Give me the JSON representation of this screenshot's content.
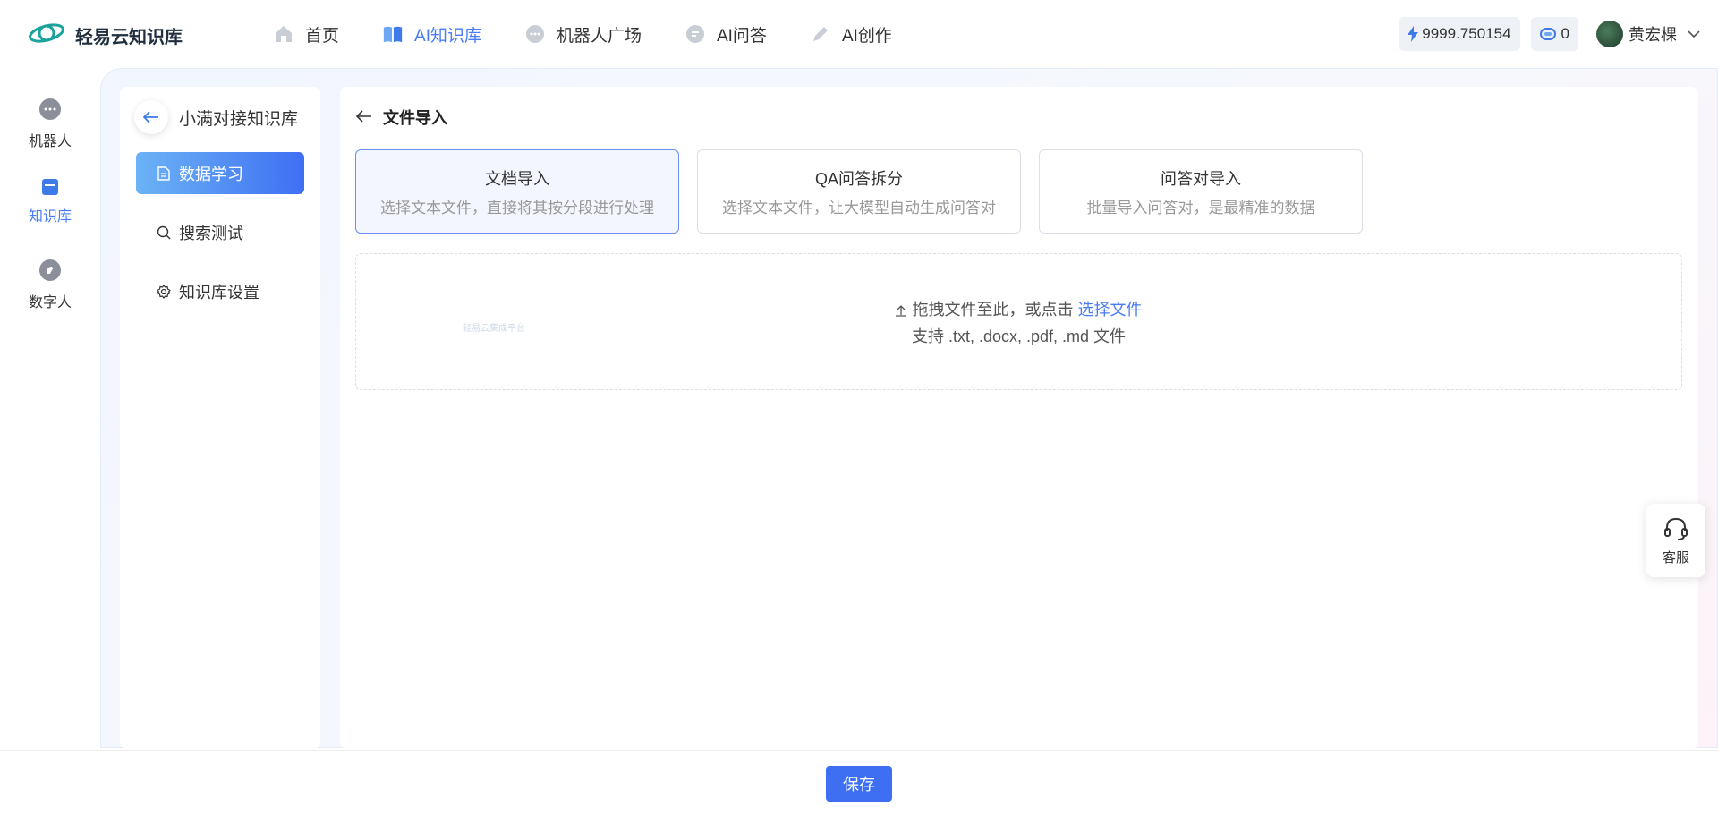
{
  "header": {
    "logo_text": "轻易云知识库",
    "nav": [
      {
        "label": "首页",
        "icon": "home-icon",
        "active": false
      },
      {
        "label": "AI知识库",
        "icon": "book-icon",
        "active": true
      },
      {
        "label": "机器人广场",
        "icon": "robot-icon",
        "active": false
      },
      {
        "label": "AI问答",
        "icon": "chat-icon",
        "active": false
      },
      {
        "label": "AI创作",
        "icon": "pen-icon",
        "active": false
      }
    ],
    "balance": "9999.750154",
    "tokens": "0",
    "username": "黄宏棵"
  },
  "rail": [
    {
      "label": "机器人",
      "icon": "robot-icon",
      "active": false
    },
    {
      "label": "知识库",
      "icon": "library-icon",
      "active": true
    },
    {
      "label": "数字人",
      "icon": "digital-human-icon",
      "active": false
    }
  ],
  "sidebar": {
    "kb_name": "小满对接知识库",
    "menu": [
      {
        "label": "数据学习",
        "icon": "document-icon",
        "active": true
      },
      {
        "label": "搜索测试",
        "icon": "search-icon",
        "active": false
      },
      {
        "label": "知识库设置",
        "icon": "gear-icon",
        "active": false
      }
    ]
  },
  "content": {
    "title": "文件导入",
    "options": [
      {
        "title": "文档导入",
        "desc": "选择文本文件，直接将其按分段进行处理",
        "active": true
      },
      {
        "title": "QA问答拆分",
        "desc": "选择文本文件，让大模型自动生成问答对",
        "active": false
      },
      {
        "title": "问答对导入",
        "desc": "批量导入问答对，是最精准的数据",
        "active": false
      }
    ],
    "dropzone": {
      "prefix": "拖拽文件至此，或点击",
      "link": "选择文件",
      "hint": "支持 .txt, .docx, .pdf, .md 文件"
    },
    "watermark": "轻易云集成平台"
  },
  "footer": {
    "save_label": "保存"
  },
  "service": {
    "label": "客服"
  },
  "colors": {
    "accent": "#4a7cf6",
    "primary_btn": "#3e6ff3"
  }
}
